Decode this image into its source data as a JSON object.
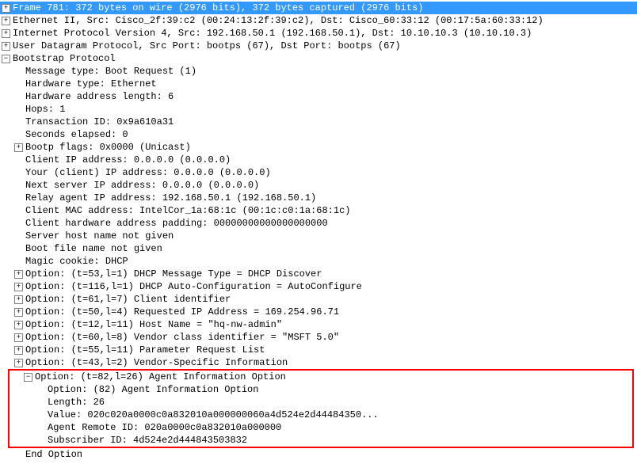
{
  "frame": {
    "summary": "Frame 781: 372 bytes on wire (2976 bits), 372 bytes captured (2976 bits)"
  },
  "eth": {
    "summary": "Ethernet II, Src: Cisco_2f:39:c2 (00:24:13:2f:39:c2), Dst: Cisco_60:33:12 (00:17:5a:60:33:12)"
  },
  "ip": {
    "summary": "Internet Protocol Version 4, Src: 192.168.50.1 (192.168.50.1), Dst: 10.10.10.3 (10.10.10.3)"
  },
  "udp": {
    "summary": "User Datagram Protocol, Src Port: bootps (67), Dst Port: bootps (67)"
  },
  "bootp": {
    "summary": "Bootstrap Protocol",
    "msg_type": "Message type: Boot Request (1)",
    "hw_type": "Hardware type: Ethernet",
    "hw_addr_len": "Hardware address length: 6",
    "hops": "Hops: 1",
    "trans_id": "Transaction ID: 0x9a610a31",
    "secs": "Seconds elapsed: 0",
    "flags": "Bootp flags: 0x0000 (Unicast)",
    "client_ip": "Client IP address: 0.0.0.0 (0.0.0.0)",
    "your_ip": "Your (client) IP address: 0.0.0.0 (0.0.0.0)",
    "next_server": "Next server IP address: 0.0.0.0 (0.0.0.0)",
    "relay": "Relay agent IP address: 192.168.50.1 (192.168.50.1)",
    "client_mac": "Client MAC address: IntelCor_1a:68:1c (00:1c:c0:1a:68:1c)",
    "padding": "Client hardware address padding: 00000000000000000000",
    "server_host": "Server host name not given",
    "boot_file": "Boot file name not given",
    "magic": "Magic cookie: DHCP",
    "opt53": "Option: (t=53,l=1) DHCP Message Type = DHCP Discover",
    "opt116": "Option: (t=116,l=1) DHCP Auto-Configuration = AutoConfigure",
    "opt61": "Option: (t=61,l=7) Client identifier",
    "opt50": "Option: (t=50,l=4) Requested IP Address = 169.254.96.71",
    "opt12": "Option: (t=12,l=11) Host Name = \"hq-nw-admin\"",
    "opt60": "Option: (t=60,l=8) Vendor class identifier = \"MSFT 5.0\"",
    "opt55": "Option: (t=55,l=11) Parameter Request List",
    "opt43": "Option: (t=43,l=2) Vendor-Specific Information",
    "opt82": {
      "summary": "Option: (t=82,l=26) Agent Information Option",
      "option": "Option: (82) Agent Information Option",
      "length": "Length: 26",
      "value": "Value: 020c020a0000c0a832010a000000060a4d524e2d44484350...",
      "remote_id": "Agent Remote ID: 020a0000c0a832010a000000",
      "subscriber_id": "Subscriber ID: 4d524e2d444843503832"
    },
    "end": "End Option"
  }
}
